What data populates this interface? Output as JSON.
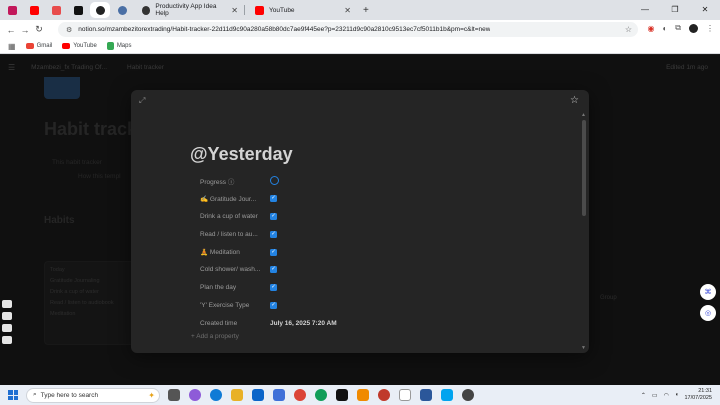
{
  "browser": {
    "tabs": [
      {
        "label": "Productivity App Idea Help",
        "icon": "chatgpt-icon"
      },
      {
        "label": "YouTube",
        "icon": "youtube-icon"
      }
    ],
    "new_tab": "+",
    "address": "notion.so/mzambezitorextrading/Habit-tracker-22d11d9c90a280a58b80dc7ae9f445ee?p=23211d9c90a2810c9513ec7cf5011b1b&pm=c&lt=new",
    "bookmarks": [
      "Gmail",
      "YouTube",
      "Maps"
    ],
    "colors": {
      "accent": "#2383e2",
      "youtube": "#ff0000"
    }
  },
  "notion_bg": {
    "breadcrumb": [
      "Mzambezi_fx Trading Of...",
      "Habit tracker"
    ],
    "edited": "Edited 1m ago",
    "title": "Habit track",
    "callout": "This habit tracker",
    "callout_sub": "How this templ",
    "section": "Habits",
    "card_header": "Today",
    "card_items": [
      "Gratitude Journaling",
      "Drink a cup of water",
      "Read / listen to audiobook",
      "Meditation"
    ],
    "right_hint": "Group"
  },
  "modal": {
    "title": "@Yesterday",
    "properties": [
      {
        "name": "Progress ⓘ",
        "type": "progress"
      },
      {
        "name": "✍ Gratitude Jour...",
        "type": "checkbox",
        "checked": true
      },
      {
        "name": "Drink a cup of water",
        "type": "checkbox",
        "checked": true
      },
      {
        "name": "Read / listen to au...",
        "type": "checkbox",
        "checked": true
      },
      {
        "name": "🧘 Meditation",
        "type": "checkbox",
        "checked": true
      },
      {
        "name": "Cold shower/ wash...",
        "type": "checkbox",
        "checked": true
      },
      {
        "name": "Plan the day",
        "type": "checkbox",
        "checked": true
      },
      {
        "name": "'Y' Exercise Type",
        "type": "checkbox",
        "checked": true
      },
      {
        "name": "Created time",
        "type": "date",
        "value": "July 16, 2025 7:20 AM"
      }
    ],
    "add_property": "+ Add a property"
  },
  "taskbar": {
    "search_placeholder": "Type here to search",
    "time": "21:31",
    "date": "17/07/2025"
  }
}
